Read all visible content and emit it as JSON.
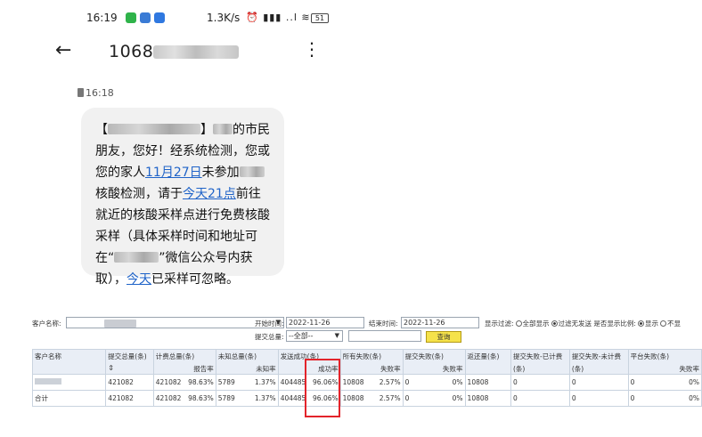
{
  "phone": {
    "status": {
      "time": "16:19",
      "net_speed": "1.3K/s",
      "signal_icons": "⏰ ▮▮▮ ..l ≋",
      "battery": "51"
    },
    "header": {
      "title_prefix": "1068",
      "back": "←",
      "menu": "⋮"
    },
    "message": {
      "time": "16:18",
      "p1": "【",
      "p2": "】",
      "p3": "的市民朋友，您好！经系统检测，您或您的家人",
      "link_date": "11月27日",
      "p4": "未参加",
      "p5": "核酸检测，请于",
      "link_time": "今天21点",
      "p6": "前往就近的核酸采样点进行免费核酸采样（具体采样时间和地址可在“",
      "p7": "”微信公众号内获取），",
      "link_today": "今天",
      "p8": "已采样可忽略。"
    },
    "colors": {
      "link": "#1f63c8",
      "bubble": "#f1f1f1"
    }
  },
  "report": {
    "filters": {
      "customer_label": "客户名称:",
      "start_label": "开始时间:",
      "start_value": "2022-11-26",
      "end_label": "结束时间:",
      "end_value": "2022-11-26",
      "show_filter_label": "显示过滤:",
      "opt_show_all": "全部显示",
      "opt_filter_unsent": "过滤无发送",
      "show_ratio_label": "是否显示比例:",
      "opt_show": "显示",
      "opt_hide": "不显",
      "submit_total_label": "提交总量:",
      "submit_total_value": "--全部--",
      "query_button": "查询"
    },
    "columns": [
      {
        "h1": "客户名称",
        "h2": ""
      },
      {
        "h1": "提交总量(条)",
        "h2": ""
      },
      {
        "h1": "计费总量(条)",
        "h2": "报告率"
      },
      {
        "h1": "未知总量(条)",
        "h2": "未知率"
      },
      {
        "h1": "发送成功(条)",
        "h2": "成功率"
      },
      {
        "h1": "所有失败(条)",
        "h2": "失败率"
      },
      {
        "h1": "提交失败(条)",
        "h2": "失败率"
      },
      {
        "h1": "返还量(条)",
        "h2": ""
      },
      {
        "h1": "提交失败-已计费",
        "h2": "(条)"
      },
      {
        "h1": "提交失败-未计费",
        "h2": "(条)"
      },
      {
        "h1": "平台失败(条)",
        "h2": "失败率"
      }
    ],
    "rows": [
      {
        "name": "",
        "c1": "421082",
        "c2a": "421082",
        "c2b": "98.63%",
        "c3a": "5789",
        "c3b": "1.37%",
        "c4a": "404485",
        "c4b": "96.06%",
        "c5a": "10808",
        "c5b": "2.57%",
        "c6a": "0",
        "c6b": "0%",
        "c7": "10808",
        "c8": "0",
        "c9": "0",
        "c10a": "0",
        "c10b": "0%"
      },
      {
        "name": "合计",
        "c1": "421082",
        "c2a": "421082",
        "c2b": "98.63%",
        "c3a": "5789",
        "c3b": "1.37%",
        "c4a": "404485",
        "c4b": "96.06%",
        "c5a": "10808",
        "c5b": "2.57%",
        "c6a": "0",
        "c6b": "0%",
        "c7": "10808",
        "c8": "0",
        "c9": "0",
        "c10a": "0",
        "c10b": "0%"
      }
    ],
    "colors": {
      "header_bg": "#e9eef6",
      "highlight": "#e3242b",
      "query_button": "#f5e24a"
    }
  }
}
